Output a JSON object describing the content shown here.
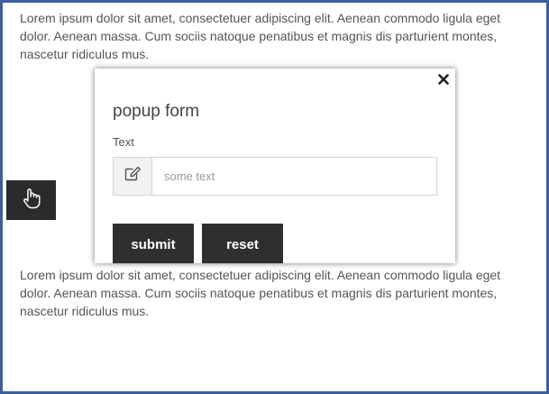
{
  "page": {
    "paragraph_top": "Lorem ipsum dolor sit amet, consectetuer adipiscing elit. Aenean commodo ligula eget dolor. Aenean massa. Cum sociis natoque penatibus et magnis dis parturient montes, nascetur ridiculus mus.",
    "paragraph_bottom": "Lorem ipsum dolor sit amet, consectetuer adipiscing elit. Aenean commodo ligula eget dolor. Aenean massa. Cum sociis natoque penatibus et magnis dis parturient montes, nascetur ridiculus mus."
  },
  "trigger": {
    "icon": "hand-pointer-icon"
  },
  "popup": {
    "title": "popup form",
    "close_icon": "close-icon",
    "field": {
      "label": "Text",
      "placeholder": "some text",
      "value": "",
      "icon": "pencil-square-icon"
    },
    "buttons": {
      "submit_label": "submit",
      "reset_label": "reset"
    }
  },
  "colors": {
    "frame_border": "#3a5f9d",
    "button_bg": "#2f2f2f",
    "trigger_bg": "#2b2b2b"
  }
}
